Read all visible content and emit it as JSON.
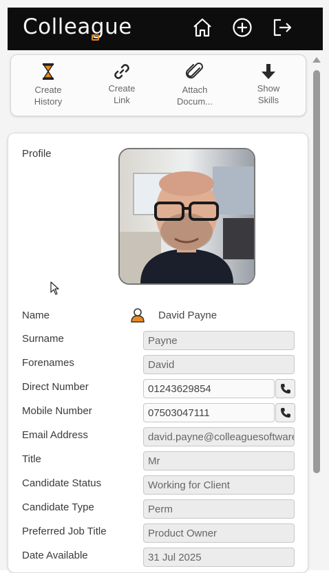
{
  "app": {
    "logo_text": "Colleague"
  },
  "header": {
    "icons": [
      "home-icon",
      "plus-circle-icon",
      "logout-icon"
    ]
  },
  "toolbar": {
    "items": [
      {
        "label": "Create\nHistory",
        "icon": "hourglass-icon"
      },
      {
        "label": "Create\nLink",
        "icon": "link-icon"
      },
      {
        "label": "Attach\nDocum...",
        "icon": "paperclip-icon"
      },
      {
        "label": "Show\nSkills",
        "icon": "arrow-down-icon"
      }
    ]
  },
  "profile": {
    "section_label": "Profile",
    "name_label": "Name",
    "name_value": "David Payne",
    "fields": {
      "surname": {
        "label": "Surname",
        "value": "Payne"
      },
      "forenames": {
        "label": "Forenames",
        "value": "David"
      },
      "direct_number": {
        "label": "Direct Number",
        "value": "01243629854"
      },
      "mobile_number": {
        "label": "Mobile Number",
        "value": "07503047111"
      },
      "email": {
        "label": "Email Address",
        "value": "david.payne@colleaguesoftware.com"
      },
      "title": {
        "label": "Title",
        "value": "Mr"
      },
      "candidate_status": {
        "label": "Candidate Status",
        "value": "Working for Client"
      },
      "candidate_type": {
        "label": "Candidate Type",
        "value": "Perm"
      },
      "preferred_job_title": {
        "label": "Preferred Job Title",
        "value": "Product Owner"
      },
      "date_available": {
        "label": "Date Available",
        "value": "31 Jul 2025"
      }
    }
  },
  "colors": {
    "header_bg": "#0d0d0d",
    "accent": "#e98a1d",
    "icon_dark": "#2a2a2a"
  }
}
